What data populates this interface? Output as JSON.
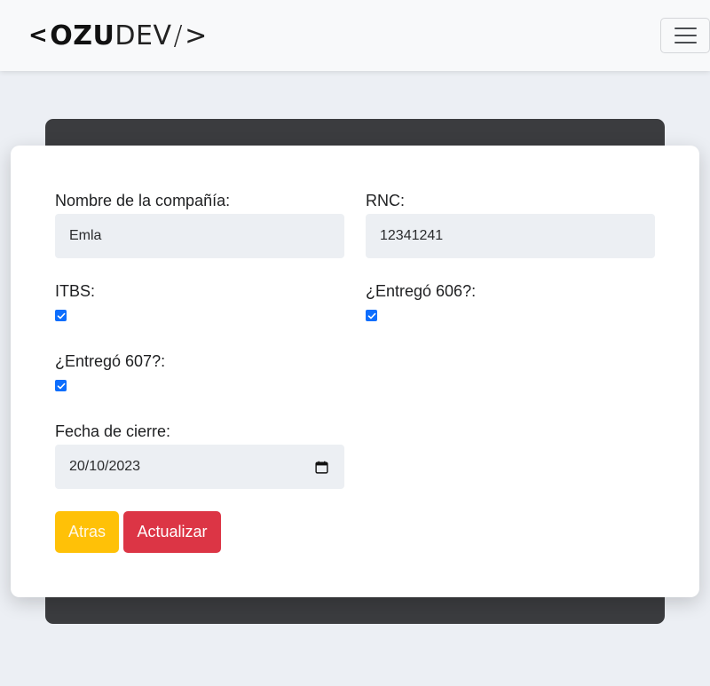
{
  "navbar": {
    "logo": {
      "lt": "<",
      "ozu": "OZU",
      "dev": "DEV",
      "slash": "/",
      "gt": ">"
    }
  },
  "form": {
    "company": {
      "label": "Nombre de la compañía:",
      "value": "Emla"
    },
    "rnc": {
      "label": "RNC:",
      "value": "12341241"
    },
    "itbs": {
      "label": "ITBS:",
      "checked": true
    },
    "entrego606": {
      "label": "¿Entregó 606?:",
      "checked": true
    },
    "entrego607": {
      "label": "¿Entregó 607?:",
      "checked": true
    },
    "fecha": {
      "label": "Fecha de cierre:",
      "value": "20/10/2023"
    }
  },
  "buttons": {
    "back": "Atras",
    "update": "Actualizar"
  },
  "colors": {
    "primary": "#0d6efd",
    "warning": "#ffc107",
    "danger": "#dc3545"
  },
  "icons": {
    "menu": "hamburger-icon",
    "calendar": "calendar-icon",
    "check": "checkmark-icon"
  }
}
